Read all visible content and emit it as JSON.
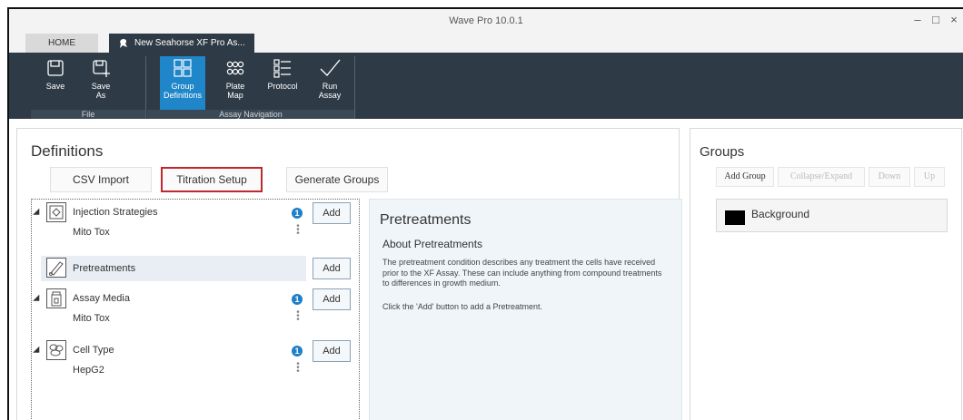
{
  "window": {
    "title": "Wave Pro 10.0.1",
    "minimize": "–",
    "maximize": "□",
    "close": "×"
  },
  "tabs": [
    {
      "label": "HOME"
    },
    {
      "label": "New Seahorse XF Pro As..."
    }
  ],
  "ribbon": {
    "buttons": [
      {
        "label": "Save",
        "icon": "save-icon"
      },
      {
        "label": "Save As",
        "icon": "save-as-icon"
      },
      {
        "label": "Group Definitions",
        "icon": "group-definitions-icon",
        "active": true
      },
      {
        "label": "Plate Map",
        "icon": "plate-map-icon"
      },
      {
        "label": "Protocol",
        "icon": "protocol-icon"
      },
      {
        "label": "Run Assay",
        "icon": "checkmark-icon"
      }
    ],
    "group_labels": {
      "file": "File",
      "assay_navigation": "Assay Navigation"
    },
    "accent": "#1f86c9",
    "background": "#2e3b46"
  },
  "definitions": {
    "title": "Definitions",
    "buttons": {
      "csv_import": "CSV Import",
      "titration_setup": "Titration Setup",
      "generate_groups": "Generate Groups"
    },
    "tree": [
      {
        "label": "Injection Strategies",
        "sub": "Mito Tox",
        "badge": "1",
        "add": "Add",
        "icon": "injection-strategies-icon"
      },
      {
        "label": "Pretreatments",
        "sub": "",
        "add": "Add",
        "icon": "pretreatment-icon",
        "selected": true
      },
      {
        "label": "Assay Media",
        "sub": "Mito Tox",
        "badge": "1",
        "add": "Add",
        "icon": "assay-media-icon"
      },
      {
        "label": "Cell Type",
        "sub": "HepG2",
        "badge": "1",
        "add": "Add",
        "icon": "cell-type-icon"
      }
    ],
    "info": {
      "title": "Pretreatments",
      "subtitle": "About Pretreatments",
      "text": "The pretreatment condition describes any treatment the cells have received prior to the XF Assay.  These can include anything from compound treatments to differences in growth medium.",
      "text2": "Click the 'Add' button to add a Pretreatment."
    }
  },
  "groups": {
    "title": "Groups",
    "buttons": {
      "add_group": "Add Group",
      "collapse_expand": "Collapse/Expand",
      "down": "Down",
      "up": "Up"
    },
    "items": [
      {
        "name": "Background",
        "color": "#000000"
      }
    ]
  }
}
